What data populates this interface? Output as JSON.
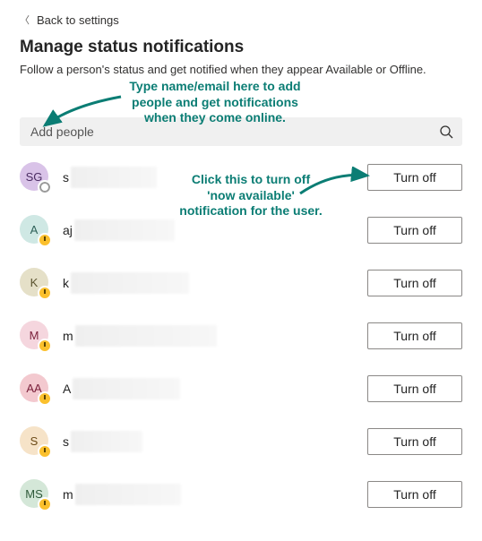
{
  "back_label": "Back to settings",
  "title": "Manage status notifications",
  "subtitle": "Follow a person's status and get notified when they appear Available or Offline.",
  "search": {
    "placeholder": "Add people"
  },
  "turn_off_label": "Turn off",
  "annotations": {
    "add_people_hint": "Type name/email here to add people and get notifications when they come online.",
    "turn_off_hint": "Click this to turn off 'now available' notification for the user."
  },
  "people": [
    {
      "initials": "SG",
      "prefix": "s",
      "avatar_bg": "#d9c3e8",
      "avatar_fg": "#4b2c63",
      "presence": "offline",
      "blur_w": 96
    },
    {
      "initials": "A",
      "prefix": "aj",
      "avatar_bg": "#cfe8e4",
      "avatar_fg": "#2e6158",
      "presence": "away",
      "blur_w": 112
    },
    {
      "initials": "K",
      "prefix": "k",
      "avatar_bg": "#e5e0c8",
      "avatar_fg": "#5a5430",
      "presence": "away",
      "blur_w": 132
    },
    {
      "initials": "M",
      "prefix": "m",
      "avatar_bg": "#f5d6de",
      "avatar_fg": "#7a1f3a",
      "presence": "away",
      "blur_w": 158
    },
    {
      "initials": "AA",
      "prefix": "A",
      "avatar_bg": "#f3c9cf",
      "avatar_fg": "#7a1f3a",
      "presence": "away",
      "blur_w": 120
    },
    {
      "initials": "S",
      "prefix": "s",
      "avatar_bg": "#f6e3c8",
      "avatar_fg": "#6b4a17",
      "presence": "away",
      "blur_w": 80
    },
    {
      "initials": "MS",
      "prefix": "m",
      "avatar_bg": "#d4e7d8",
      "avatar_fg": "#2f5a3a",
      "presence": "away",
      "blur_w": 118
    }
  ]
}
